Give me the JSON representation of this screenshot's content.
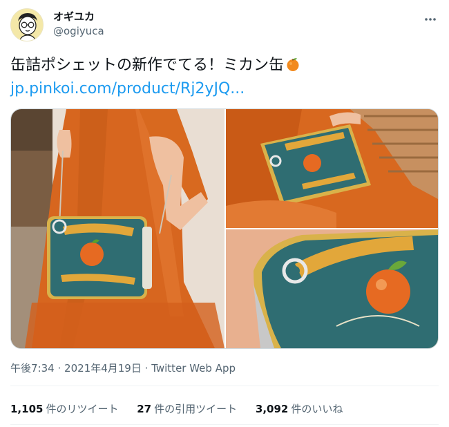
{
  "author": {
    "display_name": "オギユカ",
    "handle": "@ogiyuca",
    "avatar_icon": "illustrated-face-with-glasses"
  },
  "more_icon": "three-dots-icon",
  "tweet": {
    "text": "缶詰ポシェットの新作でてる！ミカン缶",
    "emoji": "tangerine-emoji",
    "link": "jp.pinkoi.com/product/Rj2yJQ..."
  },
  "media": {
    "count": 3,
    "colors": {
      "orange": "#d86a2a",
      "teal": "#2f6d72",
      "gold": "#d9b24a"
    }
  },
  "meta": {
    "time": "午後7:34",
    "date": "2021年4月19日",
    "source": "Twitter Web App",
    "sep": "·"
  },
  "stats": {
    "retweets": {
      "count": "1,105",
      "label": "件のリツイート"
    },
    "quotes": {
      "count": "27",
      "label": "件の引用ツイート"
    },
    "likes": {
      "count": "3,092",
      "label": "件のいいね"
    }
  }
}
